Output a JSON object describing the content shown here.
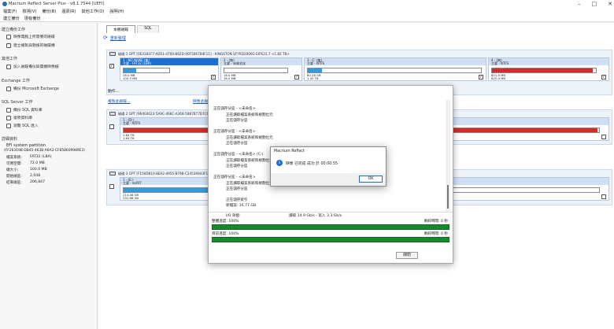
{
  "window": {
    "title": "Macrium Reflect Server Plus - v8.1.7544  [UEFI]"
  },
  "menu": [
    "檔案(F)",
    "檢視(V)",
    "備份(B)",
    "還原(R)",
    "其他工作(O)",
    "說明(H)"
  ],
  "toolbar": [
    "建立備份",
    "現有備份"
  ],
  "sidebar": {
    "sec_backup": "建立備份工作",
    "item_image_selected": "映像電腦上所需要的磁碟",
    "item_clone": "建立複製與救援的磁碟機",
    "sec_other": "其他工作",
    "item_rescue": "加入磁碟備份與開機映像檔",
    "sec_exchange": "Exchange 工作",
    "item_exchange": "備份 Microsoft Exchange",
    "sec_sql": "SQL Server 工作",
    "item_sql_backup": "備份 SQL 資料庫",
    "item_sql_restore": "復原資料庫",
    "item_sql_browse": "瀏覽 SQL 匯入",
    "sec_details": "詳細資料",
    "part_name": "EFI system partition",
    "part_guid": "(FF26319B-DB45-463B-A6A3-CF858609989E3)",
    "kv": [
      {
        "k": "檔案系統:",
        "v": "FAT32 (LBA)"
      },
      {
        "k": "可用空間:",
        "v": "72.0 MB"
      },
      {
        "k": "總大小:",
        "v": "100.0 MB"
      },
      {
        "k": "開始磁區:",
        "v": "2,048"
      },
      {
        "k": "結束磁區:",
        "v": "206,847"
      }
    ]
  },
  "tabs": [
    "本機磁碟",
    "SQL"
  ],
  "refresh": "重新整理",
  "disk1": {
    "header": "磁碟 1 GPT [0E3181F7-AD51-4700-B62D-00F5667B4F11] - KINGSTON SFYRD2000G EIFK31.7 <1.82 TB>",
    "parts": [
      {
        "hd": "1 - NO NAME (無)",
        "sub": "主要 - FAT32 (LBA)",
        "n1": "28.0 MB",
        "n2": "100.0 MB",
        "fill": 0.28,
        "color": "#2f9be0",
        "sel": true
      },
      {
        "hd": "2 - (無)",
        "sub": "主要 - 未格式化",
        "n1": "16.0 MB",
        "n2": "16.0 MB",
        "fill": 0,
        "color": "#2f9be0",
        "sel": false
      },
      {
        "hd": "3 - C: (無)",
        "sub": "主要 - NTFS",
        "n1": "80.26 GB",
        "n2": "1.00 TB",
        "fill": 0.08,
        "color": "#2f9be0",
        "sel": false
      },
      {
        "hd": "4 - (無)",
        "sub": "主要 - NTFS",
        "n1": "801.8 MB",
        "n2": "825.0 MB",
        "fill": 0.97,
        "color": "#d42a2a",
        "sel": false
      }
    ],
    "actions": "動作...",
    "clone": "複製此磁碟...",
    "image": "映像此磁碟..."
  },
  "disk2": {
    "header": "磁碟 2 GPT [96404023-5A9C-468C-A368-5887B77B7C6E] - 2ET",
    "hd": "1 - (D:)",
    "sub": "主要 - NTFS",
    "n1": "1.64 TB",
    "n2": "1.64 TB",
    "fill": 0.997,
    "color": "#d42a2a"
  },
  "disk3": {
    "header": "磁碟 3 GPT [F150D810-8EA2-4955-B798-C34536943F1A] - SSFD",
    "hd": "1 - (E:)",
    "sub": "主要 - exFAT",
    "n1": "214.48 GB",
    "n2": "232.88 GB",
    "fill": 0.28,
    "color": "#2f9be0"
  },
  "dialog": {
    "log": [
      "正在儲存分區 - <未命名>",
      "正在讀取檔案系統和規劃位元",
      "正在儲存分區",
      "正在儲存分區 - <未命名>",
      "正在讀取檔案系統和規劃位元",
      "正在儲存分區",
      "正在儲存分區 - <未命名> (C:)",
      "正在讀取檔案系統和規劃位元",
      "正在儲存分區",
      "正在儲存分區 - <未命名>",
      "正在讀取檔案系統和規劃位元",
      "正在儲存分區",
      "正在儲存索引",
      "新檔案: 16.77 GB",
      "I/O 效能:",
      "讀取 14.9 Gb/s - 寫入 3.3 Gb/s",
      "映像 已完成 成功 於 00:00:55"
    ],
    "overall_label": "整體進度: 100%",
    "overall_remain": "剩餘時間: 0 秒",
    "current_label": "目前進度: 100%",
    "current_remain": "剩餘時間: 0 秒",
    "close": "關閉"
  },
  "popup": {
    "title": "Macrium Reflect",
    "message": "映像 已完成 成功 於 00:00:55",
    "ok": "OK"
  }
}
